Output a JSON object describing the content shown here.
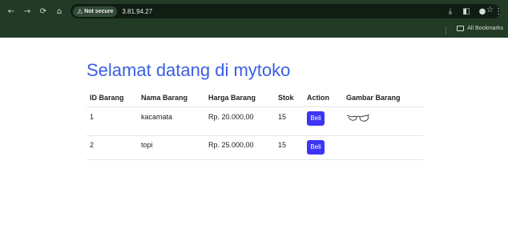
{
  "browser": {
    "security_label": "Not secure",
    "url": "3.81.94.27",
    "bookmarks_label": "All Bookmarks"
  },
  "page": {
    "title": "Selamat datang di mytoko"
  },
  "table": {
    "headers": [
      "ID Barang",
      "Nama Barang",
      "Harga Barang",
      "Stok",
      "Action",
      "Gambar Barang"
    ],
    "rows": [
      {
        "id": "1",
        "name": "kacamata",
        "price": "Rp. 20.000,00",
        "stock": "15",
        "action": "Beli",
        "image": "glasses-icon"
      },
      {
        "id": "2",
        "name": "topi",
        "price": "Rp. 25.000,00",
        "stock": "15",
        "action": "Beli",
        "image": ""
      }
    ]
  },
  "colors": {
    "browser_chrome": "#223a26",
    "title": "#3a5fe5",
    "button": "#3d34f5"
  }
}
